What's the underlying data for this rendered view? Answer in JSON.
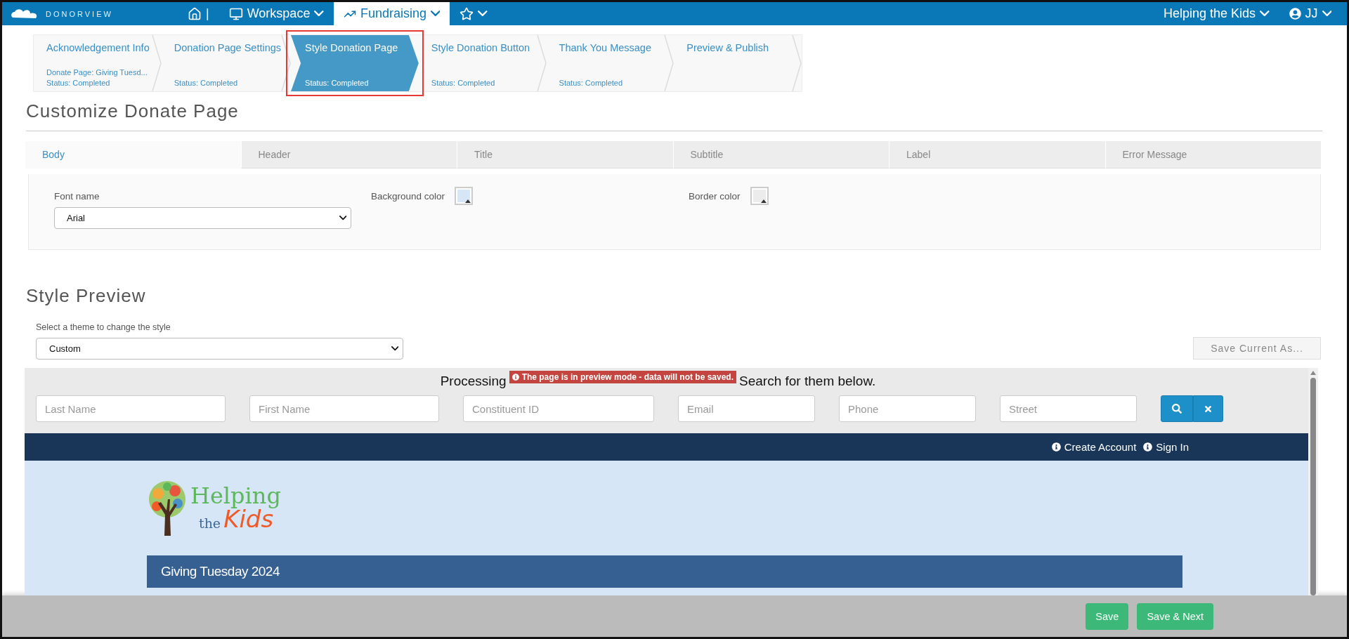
{
  "brand": {
    "name": "DONORVIEW"
  },
  "nav": {
    "separator": "|",
    "items": [
      {
        "kind": "workspace",
        "label": "Workspace",
        "selected": false
      },
      {
        "kind": "fundraising",
        "label": "Fundraising",
        "selected": true
      },
      {
        "kind": "favorites",
        "selected": false
      }
    ]
  },
  "account": {
    "organization": "Helping the Kids",
    "user": "JJ"
  },
  "steps": [
    {
      "title": "Acknowledgement Info",
      "detail": "Donate Page: Giving Tuesd...",
      "status": "Status: Completed",
      "selected": false
    },
    {
      "title": "Donation Page Settings",
      "status": "Status: Completed",
      "selected": false
    },
    {
      "title": "Style Donation Page",
      "status": "Status: Completed",
      "selected": true
    },
    {
      "title": "Style Donation Button",
      "status": "Status: Completed",
      "selected": false
    },
    {
      "title": "Thank You Message",
      "status": "Status: Completed",
      "selected": false
    },
    {
      "title": "Preview & Publish",
      "selected": false
    }
  ],
  "customize": {
    "heading": "Customize Donate Page",
    "tabs": [
      {
        "label": "Body",
        "selected": true
      },
      {
        "label": "Header",
        "selected": false
      },
      {
        "label": "Title",
        "selected": false
      },
      {
        "label": "Subtitle",
        "selected": false
      },
      {
        "label": "Label",
        "selected": false
      },
      {
        "label": "Error Message",
        "selected": false
      }
    ],
    "fields": [
      {
        "kind": "select",
        "label": "Font name",
        "value": "Arial"
      },
      {
        "kind": "color",
        "label": "Background color",
        "color": "#d6e6f7"
      },
      {
        "kind": "color",
        "label": "Border color",
        "color": "#ececec"
      }
    ]
  },
  "preview": {
    "heading": "Style Preview",
    "theme_label": "Select a theme to change the style",
    "theme_value": "Custom",
    "save_as_button": "Save Current As...",
    "prompt_start": "Processing",
    "notice": "The page is in preview mode - data will not be saved.",
    "prompt_end": "Search for them below.",
    "search_fields": [
      {
        "placeholder": "Last Name"
      },
      {
        "placeholder": "First Name"
      },
      {
        "placeholder": "Constituent ID"
      },
      {
        "placeholder": "Email"
      },
      {
        "placeholder": "Phone"
      },
      {
        "placeholder": "Street"
      }
    ],
    "account_links": [
      "Create Account",
      "Sign In"
    ],
    "logo": {
      "first": "Helping",
      "middle": "the",
      "last": "Kids"
    },
    "campaign_title": "Giving Tuesday 2024"
  },
  "footer": {
    "buttons": [
      "Save",
      "Save & Next"
    ]
  }
}
